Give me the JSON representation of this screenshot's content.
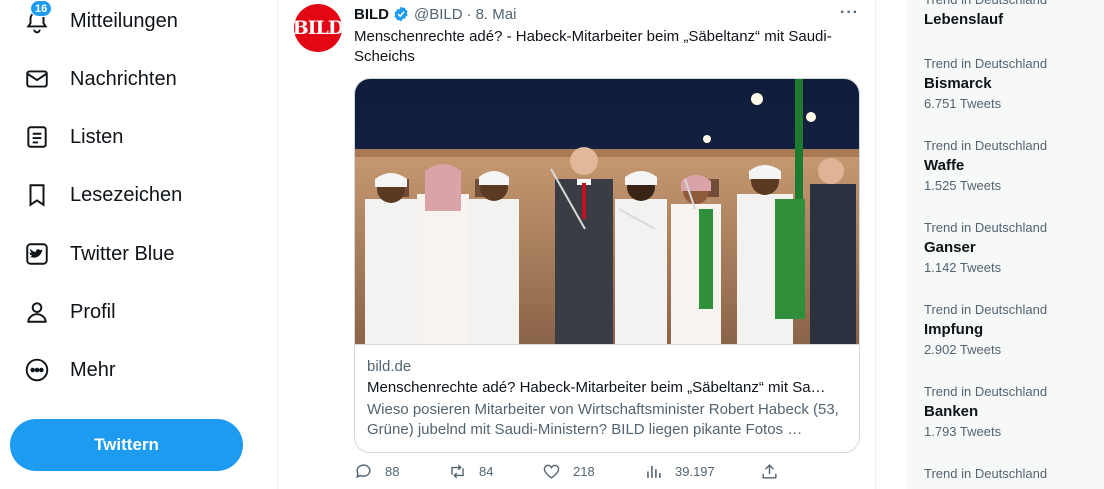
{
  "nav": {
    "notifications": {
      "label": "Mitteilungen",
      "badge": "16"
    },
    "messages": {
      "label": "Nachrichten"
    },
    "lists": {
      "label": "Listen"
    },
    "bookmarks": {
      "label": "Lesezeichen"
    },
    "twitter_blue": {
      "label": "Twitter Blue"
    },
    "profile": {
      "label": "Profil"
    },
    "more": {
      "label": "Mehr"
    },
    "tweet_button": "Twittern"
  },
  "tweet": {
    "avatar_text": "BILD",
    "author": "BILD",
    "handle": "@BILD",
    "separator": "·",
    "date": "8. Mai",
    "more": "···",
    "text": "Menschenrechte adé? - Habeck-Mitarbeiter beim „Säbeltanz“ mit Saudi-Scheichs",
    "card": {
      "domain": "bild.de",
      "title": "Menschenrechte adé? Habeck-Mitarbeiter beim „Säbeltanz“ mit Sa…",
      "description": "Wieso posieren Mitarbeiter von Wirtschaftsminister Robert Habeck (53, Grüne) jubelnd mit Saudi-Ministern? BILD liegen pikante Fotos …"
    },
    "actions": {
      "replies": "88",
      "retweets": "84",
      "likes": "218",
      "views": "39.197"
    }
  },
  "trends": [
    {
      "meta": "Trend in Deutschland",
      "name": "Lebenslauf",
      "count": ""
    },
    {
      "meta": "Trend in Deutschland",
      "name": "Bismarck",
      "count": "6.751 Tweets"
    },
    {
      "meta": "Trend in Deutschland",
      "name": "Waffe",
      "count": "1.525 Tweets"
    },
    {
      "meta": "Trend in Deutschland",
      "name": "Ganser",
      "count": "1.142 Tweets"
    },
    {
      "meta": "Trend in Deutschland",
      "name": "Impfung",
      "count": "2.902 Tweets"
    },
    {
      "meta": "Trend in Deutschland",
      "name": "Banken",
      "count": "1.793 Tweets"
    },
    {
      "meta": "Trend in Deutschland",
      "name": "",
      "count": ""
    }
  ],
  "colors": {
    "accent": "#1d9bf0",
    "brand_red": "#e30613",
    "secondary_text": "#536471"
  }
}
